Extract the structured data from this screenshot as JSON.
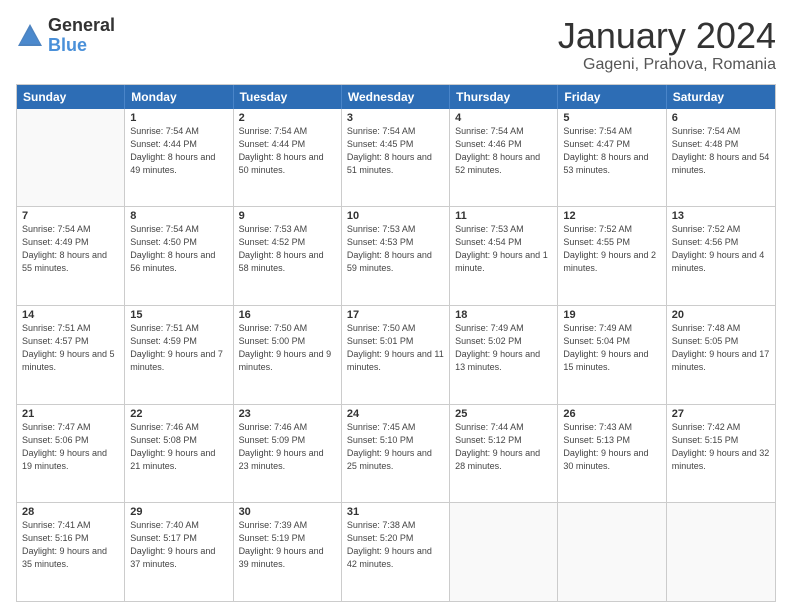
{
  "header": {
    "logo": {
      "line1": "General",
      "line2": "Blue"
    },
    "title": "January 2024",
    "location": "Gageni, Prahova, Romania"
  },
  "calendar": {
    "days_of_week": [
      "Sunday",
      "Monday",
      "Tuesday",
      "Wednesday",
      "Thursday",
      "Friday",
      "Saturday"
    ],
    "rows": [
      [
        {
          "day": "",
          "sunrise": "",
          "sunset": "",
          "daylight": "",
          "empty": true
        },
        {
          "day": "1",
          "sunrise": "Sunrise: 7:54 AM",
          "sunset": "Sunset: 4:44 PM",
          "daylight": "Daylight: 8 hours and 49 minutes.",
          "empty": false
        },
        {
          "day": "2",
          "sunrise": "Sunrise: 7:54 AM",
          "sunset": "Sunset: 4:44 PM",
          "daylight": "Daylight: 8 hours and 50 minutes.",
          "empty": false
        },
        {
          "day": "3",
          "sunrise": "Sunrise: 7:54 AM",
          "sunset": "Sunset: 4:45 PM",
          "daylight": "Daylight: 8 hours and 51 minutes.",
          "empty": false
        },
        {
          "day": "4",
          "sunrise": "Sunrise: 7:54 AM",
          "sunset": "Sunset: 4:46 PM",
          "daylight": "Daylight: 8 hours and 52 minutes.",
          "empty": false
        },
        {
          "day": "5",
          "sunrise": "Sunrise: 7:54 AM",
          "sunset": "Sunset: 4:47 PM",
          "daylight": "Daylight: 8 hours and 53 minutes.",
          "empty": false
        },
        {
          "day": "6",
          "sunrise": "Sunrise: 7:54 AM",
          "sunset": "Sunset: 4:48 PM",
          "daylight": "Daylight: 8 hours and 54 minutes.",
          "empty": false
        }
      ],
      [
        {
          "day": "7",
          "sunrise": "Sunrise: 7:54 AM",
          "sunset": "Sunset: 4:49 PM",
          "daylight": "Daylight: 8 hours and 55 minutes.",
          "empty": false
        },
        {
          "day": "8",
          "sunrise": "Sunrise: 7:54 AM",
          "sunset": "Sunset: 4:50 PM",
          "daylight": "Daylight: 8 hours and 56 minutes.",
          "empty": false
        },
        {
          "day": "9",
          "sunrise": "Sunrise: 7:53 AM",
          "sunset": "Sunset: 4:52 PM",
          "daylight": "Daylight: 8 hours and 58 minutes.",
          "empty": false
        },
        {
          "day": "10",
          "sunrise": "Sunrise: 7:53 AM",
          "sunset": "Sunset: 4:53 PM",
          "daylight": "Daylight: 8 hours and 59 minutes.",
          "empty": false
        },
        {
          "day": "11",
          "sunrise": "Sunrise: 7:53 AM",
          "sunset": "Sunset: 4:54 PM",
          "daylight": "Daylight: 9 hours and 1 minute.",
          "empty": false
        },
        {
          "day": "12",
          "sunrise": "Sunrise: 7:52 AM",
          "sunset": "Sunset: 4:55 PM",
          "daylight": "Daylight: 9 hours and 2 minutes.",
          "empty": false
        },
        {
          "day": "13",
          "sunrise": "Sunrise: 7:52 AM",
          "sunset": "Sunset: 4:56 PM",
          "daylight": "Daylight: 9 hours and 4 minutes.",
          "empty": false
        }
      ],
      [
        {
          "day": "14",
          "sunrise": "Sunrise: 7:51 AM",
          "sunset": "Sunset: 4:57 PM",
          "daylight": "Daylight: 9 hours and 5 minutes.",
          "empty": false
        },
        {
          "day": "15",
          "sunrise": "Sunrise: 7:51 AM",
          "sunset": "Sunset: 4:59 PM",
          "daylight": "Daylight: 9 hours and 7 minutes.",
          "empty": false
        },
        {
          "day": "16",
          "sunrise": "Sunrise: 7:50 AM",
          "sunset": "Sunset: 5:00 PM",
          "daylight": "Daylight: 9 hours and 9 minutes.",
          "empty": false
        },
        {
          "day": "17",
          "sunrise": "Sunrise: 7:50 AM",
          "sunset": "Sunset: 5:01 PM",
          "daylight": "Daylight: 9 hours and 11 minutes.",
          "empty": false
        },
        {
          "day": "18",
          "sunrise": "Sunrise: 7:49 AM",
          "sunset": "Sunset: 5:02 PM",
          "daylight": "Daylight: 9 hours and 13 minutes.",
          "empty": false
        },
        {
          "day": "19",
          "sunrise": "Sunrise: 7:49 AM",
          "sunset": "Sunset: 5:04 PM",
          "daylight": "Daylight: 9 hours and 15 minutes.",
          "empty": false
        },
        {
          "day": "20",
          "sunrise": "Sunrise: 7:48 AM",
          "sunset": "Sunset: 5:05 PM",
          "daylight": "Daylight: 9 hours and 17 minutes.",
          "empty": false
        }
      ],
      [
        {
          "day": "21",
          "sunrise": "Sunrise: 7:47 AM",
          "sunset": "Sunset: 5:06 PM",
          "daylight": "Daylight: 9 hours and 19 minutes.",
          "empty": false
        },
        {
          "day": "22",
          "sunrise": "Sunrise: 7:46 AM",
          "sunset": "Sunset: 5:08 PM",
          "daylight": "Daylight: 9 hours and 21 minutes.",
          "empty": false
        },
        {
          "day": "23",
          "sunrise": "Sunrise: 7:46 AM",
          "sunset": "Sunset: 5:09 PM",
          "daylight": "Daylight: 9 hours and 23 minutes.",
          "empty": false
        },
        {
          "day": "24",
          "sunrise": "Sunrise: 7:45 AM",
          "sunset": "Sunset: 5:10 PM",
          "daylight": "Daylight: 9 hours and 25 minutes.",
          "empty": false
        },
        {
          "day": "25",
          "sunrise": "Sunrise: 7:44 AM",
          "sunset": "Sunset: 5:12 PM",
          "daylight": "Daylight: 9 hours and 28 minutes.",
          "empty": false
        },
        {
          "day": "26",
          "sunrise": "Sunrise: 7:43 AM",
          "sunset": "Sunset: 5:13 PM",
          "daylight": "Daylight: 9 hours and 30 minutes.",
          "empty": false
        },
        {
          "day": "27",
          "sunrise": "Sunrise: 7:42 AM",
          "sunset": "Sunset: 5:15 PM",
          "daylight": "Daylight: 9 hours and 32 minutes.",
          "empty": false
        }
      ],
      [
        {
          "day": "28",
          "sunrise": "Sunrise: 7:41 AM",
          "sunset": "Sunset: 5:16 PM",
          "daylight": "Daylight: 9 hours and 35 minutes.",
          "empty": false
        },
        {
          "day": "29",
          "sunrise": "Sunrise: 7:40 AM",
          "sunset": "Sunset: 5:17 PM",
          "daylight": "Daylight: 9 hours and 37 minutes.",
          "empty": false
        },
        {
          "day": "30",
          "sunrise": "Sunrise: 7:39 AM",
          "sunset": "Sunset: 5:19 PM",
          "daylight": "Daylight: 9 hours and 39 minutes.",
          "empty": false
        },
        {
          "day": "31",
          "sunrise": "Sunrise: 7:38 AM",
          "sunset": "Sunset: 5:20 PM",
          "daylight": "Daylight: 9 hours and 42 minutes.",
          "empty": false
        },
        {
          "day": "",
          "sunrise": "",
          "sunset": "",
          "daylight": "",
          "empty": true
        },
        {
          "day": "",
          "sunrise": "",
          "sunset": "",
          "daylight": "",
          "empty": true
        },
        {
          "day": "",
          "sunrise": "",
          "sunset": "",
          "daylight": "",
          "empty": true
        }
      ]
    ]
  }
}
